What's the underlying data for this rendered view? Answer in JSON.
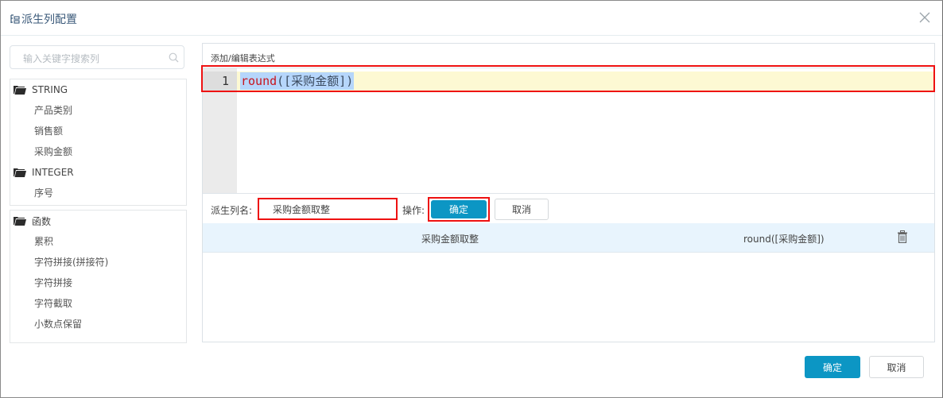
{
  "dialog": {
    "title": "派生列配置",
    "title_icon": "column-config-icon",
    "close_icon": "close-icon"
  },
  "sidebar": {
    "search": {
      "placeholder": "输入关键字搜索列",
      "value": "",
      "icon": "search-icon"
    },
    "field_groups": [
      {
        "label": "STRING",
        "icon": "folder-icon",
        "items": [
          "产品类别",
          "销售额",
          "采购金额"
        ]
      },
      {
        "label": "INTEGER",
        "icon": "folder-icon",
        "items": [
          "序号"
        ]
      }
    ],
    "function_groups": [
      {
        "label": "函数",
        "icon": "folder-icon",
        "items": [
          "累积",
          "字符拼接(拼接符)",
          "字符拼接",
          "字符截取",
          "小数点保留"
        ]
      }
    ]
  },
  "editor": {
    "label": "添加/编辑表达式",
    "line_number": "1",
    "code_keyword": "round",
    "code_rest": "([采购金额])"
  },
  "derived_column": {
    "name_label": "派生列名:",
    "name_value": "采购金额取整",
    "op_label": "操作:",
    "ok_label": "确定",
    "cancel_label": "取消"
  },
  "results": [
    {
      "name": "采购金额取整",
      "expression": "round([采购金额])",
      "delete_icon": "trash-icon"
    }
  ],
  "footer": {
    "ok_label": "确定",
    "cancel_label": "取消"
  },
  "colors": {
    "primary": "#0c96c4",
    "highlight_border": "#ee1111",
    "selected_row": "#e8f4fd",
    "active_line": "#fdf9d3"
  }
}
